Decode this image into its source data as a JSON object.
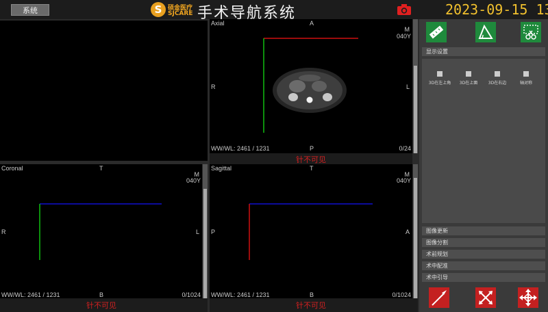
{
  "topbar": {
    "system_button": "系统",
    "logo_cn": "硕金医疗",
    "logo_en": "SJCARE",
    "logo_letter": "S",
    "title": "手术导航系统",
    "datetime": "2023-09-15 13:"
  },
  "viewports": {
    "axial": {
      "name": "Axial",
      "top": "A",
      "right_top": "M",
      "age": "040Y",
      "left": "R",
      "right": "L",
      "bottom": "P",
      "wwwl": "WW/WL: 2461 / 1231",
      "slice": "0/24",
      "warning": "针不可见"
    },
    "coronal": {
      "name": "Coronal",
      "top": "T",
      "right_top": "M",
      "age": "040Y",
      "left": "R",
      "right": "L",
      "bottom": "B",
      "wwwl": "WW/WL: 2461 / 1231",
      "slice": "0/1024",
      "warning": "针不可见"
    },
    "sagittal": {
      "name": "Sagittal",
      "top": "T",
      "right_top": "M",
      "age": "040Y",
      "left": "P",
      "right": "A",
      "bottom": "B",
      "wwwl": "WW/WL: 2461 / 1231",
      "slice": "0/1024",
      "warning": "针不可见"
    }
  },
  "panel": {
    "display_settings": "显示设置",
    "options": [
      "3D在左上角",
      "3D在上面",
      "3D在右边",
      "轴对称"
    ],
    "menu": [
      "图像更新",
      "图像分割",
      "术前规划",
      "术中配准",
      "术中引导"
    ]
  },
  "colors": {
    "accent_gold": "#f2c12e",
    "tool_green": "#1f8a3c",
    "tool_red": "#c42020",
    "axis_red": "#d01010",
    "axis_green": "#10c010",
    "axis_blue": "#1010d0"
  }
}
